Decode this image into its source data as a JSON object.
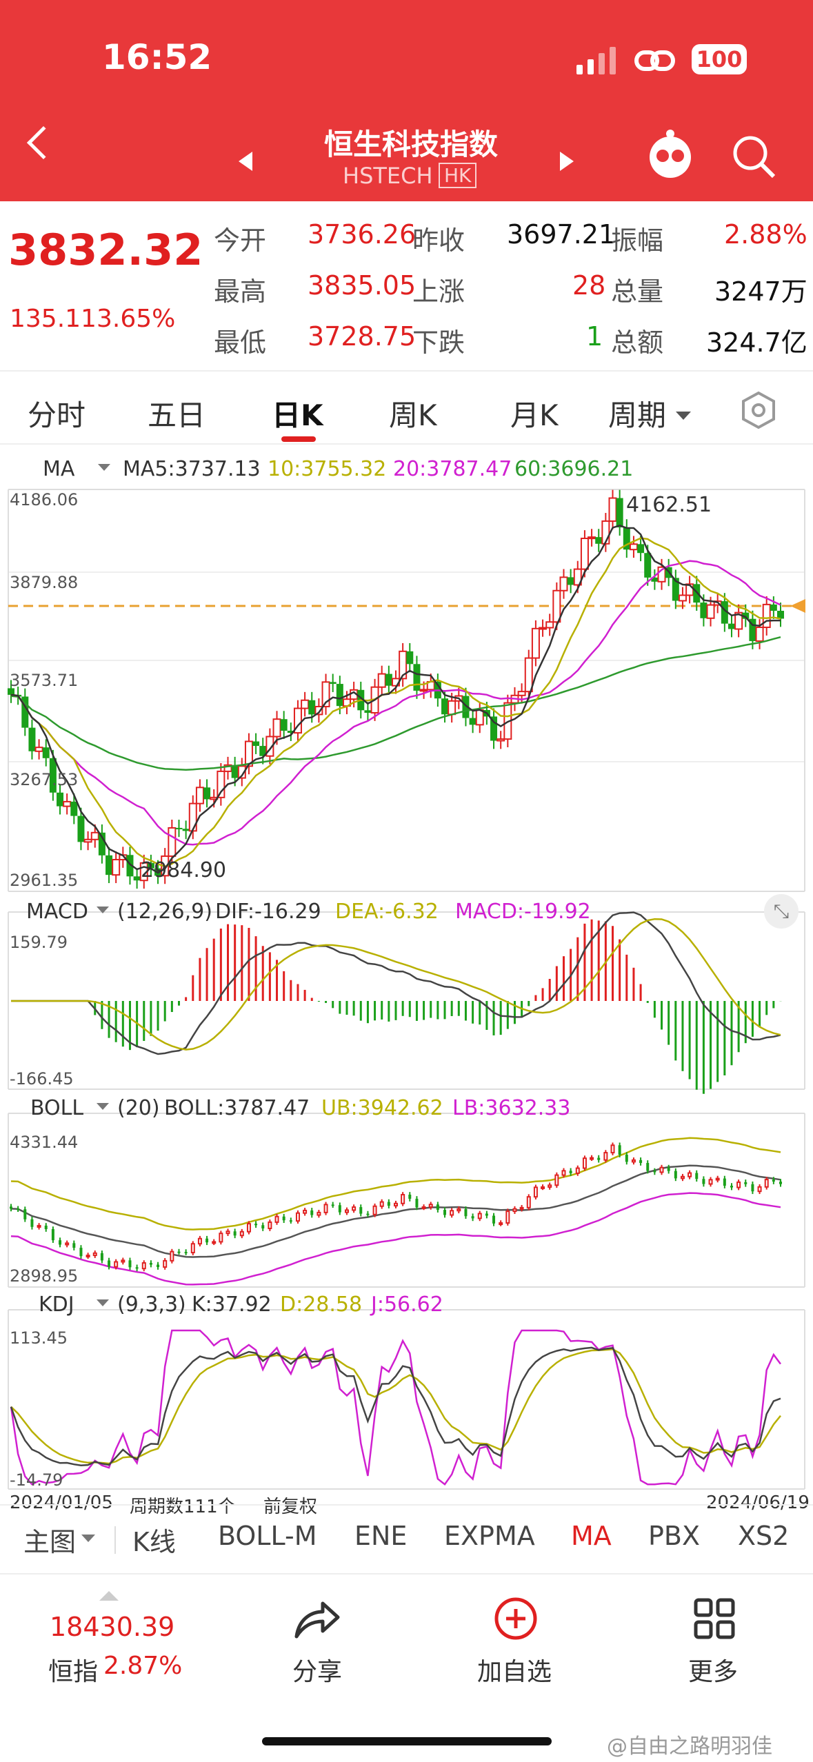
{
  "status": {
    "time": "16:52",
    "battery": "100"
  },
  "header": {
    "title": "恒生科技指数",
    "code": "HSTECH",
    "market": "HK"
  },
  "quote": {
    "price": "3832.32",
    "change": "135.11",
    "pct": "3.65%",
    "rows": [
      {
        "l1": "今开",
        "v1": "3736.26",
        "l2": "昨收",
        "v2": "3697.21",
        "l3": "振幅",
        "v3": "2.88%"
      },
      {
        "l1": "最高",
        "v1": "3835.05",
        "l2": "上涨",
        "v2": "28",
        "l3": "总量",
        "v3": "3247万"
      },
      {
        "l1": "最低",
        "v1": "3728.75",
        "l2": "下跌",
        "v2": "1",
        "l3": "总额",
        "v3": "324.7亿"
      }
    ]
  },
  "tabs": [
    "分时",
    "五日",
    "日K",
    "周K",
    "月K",
    "周期"
  ],
  "ma": {
    "name": "MA",
    "ma5": "MA5:3737.13",
    "ma10": "10:3755.32",
    "ma20": "20:3787.47",
    "ma60": "60:3696.21",
    "y1": "4186.06",
    "y2": "3879.88",
    "y3": "3573.71",
    "y4": "3267.53",
    "y5": "2961.35",
    "hi": "4162.51",
    "lo": "2984.90"
  },
  "macd": {
    "name": "MACD",
    "param": "(12,26,9)",
    "dif": "DIF:-16.29",
    "dea": "DEA:-6.32",
    "macd": "MACD:-19.92",
    "ytop": "159.79",
    "ybot": "-166.45"
  },
  "boll": {
    "name": "BOLL",
    "param": "(20)",
    "mid": "BOLL:3787.47",
    "ub": "UB:3942.62",
    "lb": "LB:3632.33",
    "ytop": "4331.44",
    "ybot": "2898.95"
  },
  "kdj": {
    "name": "KDJ",
    "param": "(9,3,3)",
    "k": "K:37.92",
    "d": "D:28.58",
    "j": "J:56.62",
    "ytop": "113.45",
    "ybot": "-14.79"
  },
  "axis": {
    "start": "2024/01/05",
    "count": "周期数111个",
    "adj": "前复权",
    "end": "2024/06/19"
  },
  "indicators": [
    "主图",
    "K线",
    "BOLL-M",
    "ENE",
    "EXPMA",
    "MA",
    "PBX",
    "XS2"
  ],
  "footer": {
    "hsi_value": "18430.39",
    "hsi_label": "恒指",
    "hsi_pct": "2.87%",
    "share": "分享",
    "add": "加自选",
    "more": "更多"
  },
  "watermark": "@自由之路明羽佳",
  "colors": {
    "up": "#e02020",
    "down": "#1aa01a",
    "ma5": "#333333",
    "ma10": "#b8b000",
    "ma20": "#d020d0",
    "ma60": "#2e9a2e",
    "header": "#e8383a"
  }
}
